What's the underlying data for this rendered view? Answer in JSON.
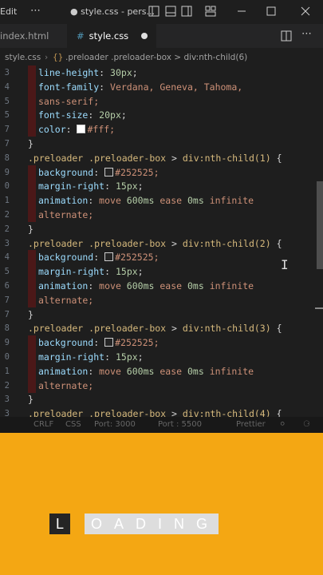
{
  "titlebar": {
    "menu_label": "Edit",
    "more": "⋯",
    "title": "● style.css - pers..."
  },
  "tabs": [
    {
      "label": "index.html"
    },
    {
      "label": "style.css"
    }
  ],
  "breadcrumb": {
    "file": "style.css",
    "path": ".preloader .preloader-box > div:nth-child(6)"
  },
  "code_lines": [
    {
      "ln": "3",
      "prop": "line-height",
      "val_num": "30",
      "val_unit": "px"
    },
    {
      "ln": "4",
      "prop": "font-family",
      "val": "Verdana, Geneva, Tahoma,"
    },
    {
      "ln": "5",
      "val": "sans-serif;"
    },
    {
      "ln": "5",
      "prop": "font-size",
      "val_num": "20",
      "val_unit": "px"
    },
    {
      "ln": "7",
      "prop": "color",
      "val": "#fff;"
    },
    {
      "ln": "7",
      "text": "}"
    },
    {
      "ln": "8",
      "sel1": ".preloader .preloader-box",
      "pseudo": "div:nth-child(1)"
    },
    {
      "ln": "9",
      "prop": "background",
      "val": "#252525;"
    },
    {
      "ln": "0",
      "prop": "margin-right",
      "val_num": "15",
      "val_unit": "px"
    },
    {
      "ln": "1",
      "prop": "animation",
      "val_a": "move",
      "val_num": "600",
      "val_unit": "ms",
      "val_b": "ease",
      "val_num2": "0",
      "val_unit2": "ms",
      "val_c": "infinite"
    },
    {
      "ln": "2",
      "val": "alternate;"
    },
    {
      "ln": "2",
      "text": "}"
    },
    {
      "ln": "3",
      "sel1": ".preloader .preloader-box",
      "pseudo": "div:nth-child(2)"
    },
    {
      "ln": "4",
      "prop": "background",
      "val": "#252525;"
    },
    {
      "ln": "5",
      "prop": "margin-right",
      "val_num": "15",
      "val_unit": "px"
    },
    {
      "ln": "6",
      "prop": "animation",
      "val_a": "move",
      "val_num": "600",
      "val_unit": "ms",
      "val_b": "ease",
      "val_num2": "0",
      "val_unit2": "ms",
      "val_c": "infinite"
    },
    {
      "ln": "7",
      "val": "alternate;"
    },
    {
      "ln": "7",
      "text": "}"
    },
    {
      "ln": "8",
      "sel1": ".preloader .preloader-box",
      "pseudo": "div:nth-child(3)"
    },
    {
      "ln": "9",
      "prop": "background",
      "val": "#252525;"
    },
    {
      "ln": "0",
      "prop": "margin-right",
      "val_num": "15",
      "val_unit": "px"
    },
    {
      "ln": "1",
      "prop": "animation",
      "val_a": "move",
      "val_num": "600",
      "val_unit": "ms",
      "val_b": "ease",
      "val_num2": "0",
      "val_unit2": "ms",
      "val_c": "infinite"
    },
    {
      "ln": "2",
      "val": "alternate;"
    },
    {
      "ln": "3",
      "text": "}"
    },
    {
      "ln": "3",
      "sel1": ".preloader .preloader-box",
      "pseudo": "div:nth-child(4)"
    }
  ],
  "statusbar": {
    "eol": "CRLF",
    "lang": "CSS",
    "port1": "Port: 3000",
    "port2": "Port : 5500",
    "prettier": "Prettier"
  },
  "preview": {
    "first_letter": "L",
    "rest_letters": "OADING",
    "bg_color": "#f4a713"
  }
}
